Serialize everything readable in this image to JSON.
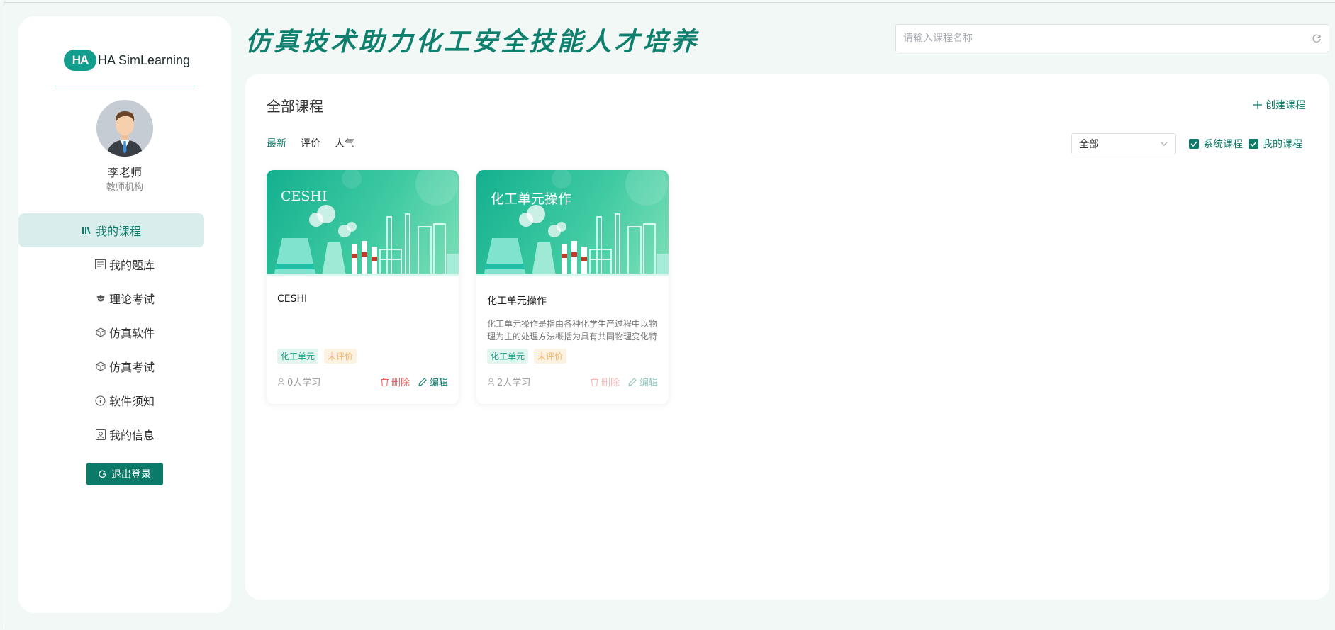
{
  "header": {
    "slogan": "仿真技术助力化工安全技能人才培养",
    "search_placeholder": "请输入课程名称"
  },
  "brand": {
    "badge": "HA",
    "name": "HA SimLearning",
    "accent_color": "#0c7a69"
  },
  "user": {
    "name": "李老师",
    "org": "教师机构"
  },
  "menu": [
    {
      "label": "我的课程",
      "icon": "books-icon",
      "active": true
    },
    {
      "label": "我的题库",
      "icon": "question-bank-icon",
      "active": false
    },
    {
      "label": "理论考试",
      "icon": "exam-cap-icon",
      "active": false
    },
    {
      "label": "仿真软件",
      "icon": "cube-icon",
      "active": false
    },
    {
      "label": "仿真考试",
      "icon": "cube-icon",
      "active": false
    },
    {
      "label": "软件须知",
      "icon": "info-icon",
      "active": false
    },
    {
      "label": "我的信息",
      "icon": "user-card-icon",
      "active": false
    }
  ],
  "logout_label": "退出登录",
  "panel": {
    "title": "全部课程",
    "create_label": "创建课程",
    "sort_tabs": [
      {
        "label": "最新",
        "active": true
      },
      {
        "label": "评价",
        "active": false
      },
      {
        "label": "人气",
        "active": false
      }
    ],
    "filter_select": "全部",
    "checkboxes": [
      {
        "label": "系统课程",
        "checked": true
      },
      {
        "label": "我的课程",
        "checked": true
      }
    ]
  },
  "courses": [
    {
      "banner_title": "CESHI",
      "name": "CESHI",
      "description": "",
      "tags": [
        "化工单元",
        "未评价"
      ],
      "learners": "0人学习",
      "delete_label": "删除",
      "edit_label": "编辑",
      "actions_faded": false
    },
    {
      "banner_title": "化工单元操作",
      "name": "化工单元操作",
      "description": "化工单元操作是指由各种化学生产过程中以物理为主的处理方法概括为具有共同物理变化特",
      "tags": [
        "化工单元",
        "未评价"
      ],
      "learners": "2人学习",
      "delete_label": "删除",
      "edit_label": "编辑",
      "actions_faded": true
    }
  ]
}
